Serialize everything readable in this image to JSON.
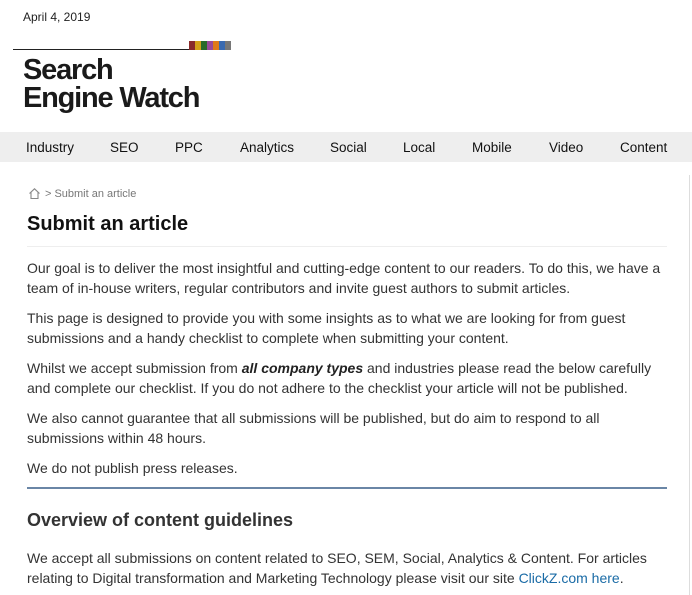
{
  "header": {
    "date": "April 4, 2019",
    "logo_line1": "Search",
    "logo_line2": "Engine Watch",
    "stripe_colors": [
      "#8a2a2a",
      "#d4a017",
      "#2a6a2a",
      "#9a4a9a",
      "#e07a1a",
      "#3a6ab0",
      "#777777"
    ]
  },
  "nav": {
    "items": [
      {
        "label": "Industry"
      },
      {
        "label": "SEO"
      },
      {
        "label": "PPC"
      },
      {
        "label": "Analytics"
      },
      {
        "label": "Social"
      },
      {
        "label": "Local"
      },
      {
        "label": "Mobile"
      },
      {
        "label": "Video"
      },
      {
        "label": "Content"
      }
    ]
  },
  "breadcrumb": {
    "home_icon": "home-icon",
    "separator": ">",
    "current": "Submit an article"
  },
  "page": {
    "title": "Submit an article",
    "p1": "Our goal is to deliver the most insightful and cutting-edge content to our readers. To do this, we have a team of in-house writers, regular contributors and invite guest authors to submit articles.",
    "p2": "This page is designed to provide you with some insights as to what we are looking for from guest submissions and a handy checklist to complete when submitting your content.",
    "p3_before": "Whilst we accept submission from ",
    "p3_em": "all company types",
    "p3_after": " and industries please read the below carefully and complete our checklist. If you do not adhere to the checklist your article will not be published.",
    "p4": "We also cannot guarantee that all submissions will be published, but do aim to respond to all submissions within 48 hours.",
    "p5": "We do not publish press releases.",
    "section_title": "Overview of content guidelines",
    "p6_before": "We accept all submissions on content related to SEO, SEM, Social, Analytics & Content. For articles relating to Digital transformation and Marketing Technology please visit our site ",
    "p6_link": "ClickZ.com here",
    "p6_after": "."
  },
  "colors": {
    "nav_bg": "#eeeeee",
    "link": "#1a6ba6",
    "rule": "#6a86a6"
  }
}
